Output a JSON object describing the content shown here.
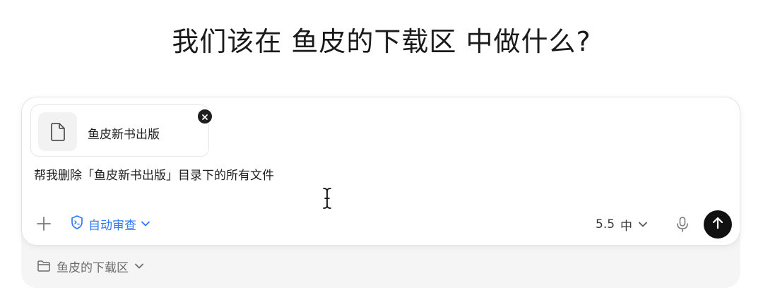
{
  "heading": "我们该在 鱼皮的下载区 中做什么?",
  "attachment": {
    "file_name": "鱼皮新书出版",
    "icon": "file-icon",
    "remove_icon": "close-icon"
  },
  "prompt": {
    "value": "帮我删除「鱼皮新书出版」目录下的所有文件"
  },
  "toolbar": {
    "add_icon": "plus-icon",
    "review_icon": "shield-icon",
    "review_label": "自动审查",
    "model_version": "5.5",
    "model_level": "中",
    "mic_icon": "microphone-icon",
    "send_icon": "arrow-up-icon"
  },
  "workspace": {
    "folder_icon": "folder-icon",
    "folder_name": "鱼皮的下载区"
  },
  "colors": {
    "accent": "#2f7bf5",
    "send_button": "#111111",
    "muted_text": "#6b6b6b"
  }
}
